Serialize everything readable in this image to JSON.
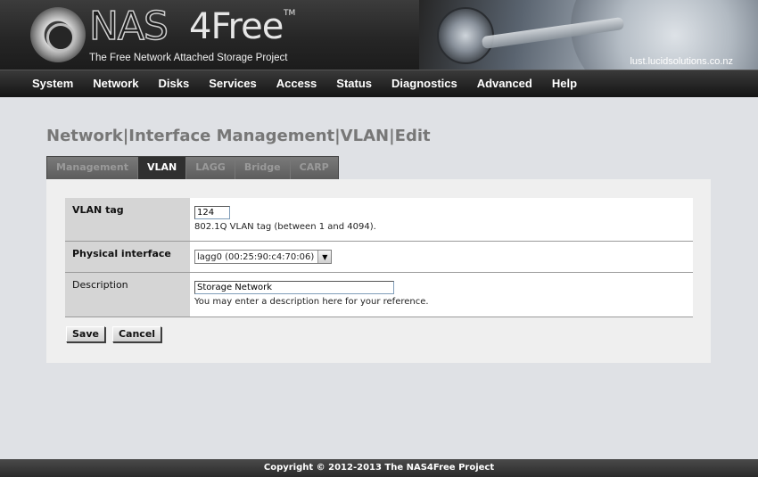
{
  "header": {
    "logo_nas": "NAS",
    "logo_4free": "4Free",
    "logo_tm": "TM",
    "tagline": "The Free Network Attached Storage Project",
    "hostname": "lust.lucidsolutions.co.nz"
  },
  "nav": {
    "items": [
      "System",
      "Network",
      "Disks",
      "Services",
      "Access",
      "Status",
      "Diagnostics",
      "Advanced",
      "Help"
    ]
  },
  "page": {
    "title": "Network|Interface Management|VLAN|Edit"
  },
  "tabs": [
    {
      "label": "Management",
      "active": false
    },
    {
      "label": "VLAN",
      "active": true
    },
    {
      "label": "LAGG",
      "active": false
    },
    {
      "label": "Bridge",
      "active": false
    },
    {
      "label": "CARP",
      "active": false
    }
  ],
  "form": {
    "vlan_tag": {
      "label": "VLAN tag",
      "value": "124",
      "hint": "802.1Q VLAN tag (between 1 and 4094)."
    },
    "physical_interface": {
      "label": "Physical interface",
      "selected": "lagg0 (00:25:90:c4:70:06)"
    },
    "description": {
      "label": "Description",
      "value": "Storage Network",
      "hint": "You may enter a description here for your reference."
    }
  },
  "buttons": {
    "save": "Save",
    "cancel": "Cancel"
  },
  "footer": {
    "copyright": "Copyright © 2012-2013 The NAS4Free Project"
  }
}
